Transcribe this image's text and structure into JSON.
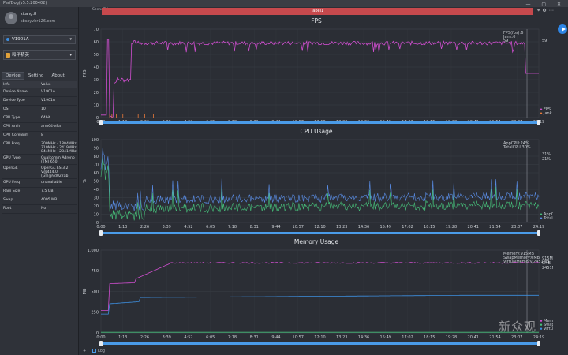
{
  "app": {
    "title": "PerfDog(v5.5.200402)"
  },
  "window_buttons": "—  ▢  ✕",
  "user": {
    "name": "zitang.8",
    "email": "sbsxyvhr126.com"
  },
  "device_select": {
    "label": "V1901A"
  },
  "app_select": {
    "label": "和平精英"
  },
  "left_tabs": [
    {
      "label": "Device",
      "active": true
    },
    {
      "label": "Setting",
      "active": false
    },
    {
      "label": "About",
      "active": false
    }
  ],
  "info_table": {
    "headers": [
      "Info",
      "Value"
    ],
    "rows": [
      [
        "Device Name",
        "V1901A"
      ],
      [
        "Device Type",
        "V1901A"
      ],
      [
        "OS",
        "10"
      ],
      [
        "CPU Type",
        "64bit"
      ],
      [
        "CPU Arch",
        "arm64-v8a"
      ],
      [
        "CPU CoreNum",
        "8"
      ],
      [
        "CPU Freq",
        "300MHz - 1804MHz\n710MHz - 2419MHz\n844MHz - 2841MHz"
      ],
      [
        "GPU Type",
        "Qualcomm Adreno\n(TM) 650"
      ],
      [
        "OpenGL",
        "OpenGL ES 3.2\nV@444.0\n(GIT@9d022ab"
      ],
      [
        "GPU Freq",
        "unavailable"
      ],
      [
        "Ram Size",
        "7.5 GB"
      ],
      [
        "Swap",
        "4095 MB"
      ],
      [
        "Root",
        "No"
      ]
    ]
  },
  "top": {
    "scene_label": "SceneTab",
    "tab_label": "label1",
    "icons": [
      "location-icon",
      "gear-icon",
      "ellipsis-icon"
    ]
  },
  "x_ticks": [
    "0:00",
    "1:13",
    "2:26",
    "3:39",
    "4:52",
    "6:05",
    "7:18",
    "8:31",
    "9:44",
    "10:57",
    "12:10",
    "13:23",
    "14:36",
    "15:49",
    "17:02",
    "18:15",
    "19:28",
    "20:41",
    "21:54",
    "23:07",
    "24:19"
  ],
  "panels": {
    "fps": {
      "title": "FPS",
      "ylabel": "FPS",
      "yticks": [
        "0",
        "10",
        "20",
        "30",
        "40",
        "50",
        "60",
        "70"
      ],
      "annotation": [
        "FPS(fps):6",
        "Jank:0",
        "59"
      ],
      "right_value": "59",
      "right_value2": "0",
      "legend": [
        {
          "name": "FPS",
          "color": "#d04ed0"
        },
        {
          "name": "Jank",
          "color": "#e87a3a"
        }
      ]
    },
    "cpu": {
      "title": "CPU Usage",
      "ylabel": "%",
      "yticks": [
        "0",
        "10",
        "20",
        "30",
        "40",
        "50",
        "60",
        "70",
        "80",
        "90",
        "100"
      ],
      "annotation": [
        "AppCPU:24%",
        "TotalCPU:30%"
      ],
      "right_values": [
        "31%",
        "21%"
      ],
      "legend": [
        {
          "name": "AppCPU",
          "color": "#46c07a"
        },
        {
          "name": "TotalCPU",
          "color": "#5a8ee8"
        }
      ]
    },
    "mem": {
      "title": "Memory Usage",
      "ylabel": "MB",
      "yticks": [
        "0",
        "250",
        "500",
        "750",
        "1,000"
      ],
      "annotation": [
        "Memory:915MB",
        "SwapMemory:0MB",
        "VirtualMemory:2451MB"
      ],
      "right_values": [
        "915MB",
        "0MB",
        "2451MB"
      ],
      "legend": [
        {
          "name": "Memory",
          "color": "#d04ed0"
        },
        {
          "name": "SwapMemory",
          "color": "#46c07a"
        },
        {
          "name": "VirtualMemory",
          "color": "#3d8fe0"
        }
      ]
    }
  },
  "bottom": {
    "plus": "+",
    "log_label": "Log"
  },
  "watermark": "新众观"
}
